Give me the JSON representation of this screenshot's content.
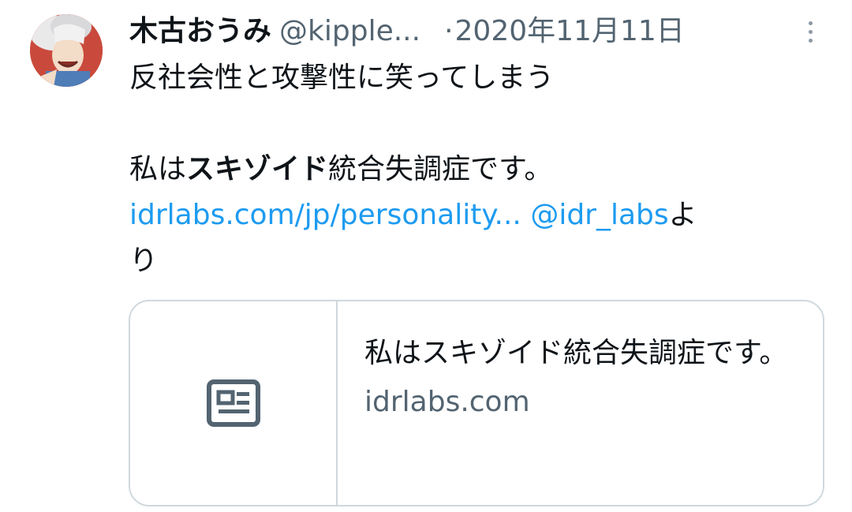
{
  "tweet": {
    "author": {
      "display_name": "木古おうみ",
      "handle": "@kipple..."
    },
    "separator": "·",
    "date": "2020年11月11日",
    "text": {
      "line1": "反社会性と攻撃性に笑ってしまう",
      "line2_prefix": "私は",
      "line2_bold": "スキゾイド",
      "line2_suffix": "統合失調症です。",
      "link_url": "idrlabs.com/jp/personality...",
      "link_space": " ",
      "mention": "@idr_labs",
      "yo": "よ",
      "ri": "り"
    },
    "card": {
      "title": "私はスキゾイド統合失調症です。",
      "domain": "idrlabs.com"
    }
  },
  "icons": {
    "more": "more-vertical-icon",
    "card": "news-article-icon"
  },
  "colors": {
    "text_primary": "#0f1419",
    "text_secondary": "#536471",
    "link": "#1d9bf0",
    "border": "#cfd9de",
    "avatar_bg": "#c94a3c"
  }
}
